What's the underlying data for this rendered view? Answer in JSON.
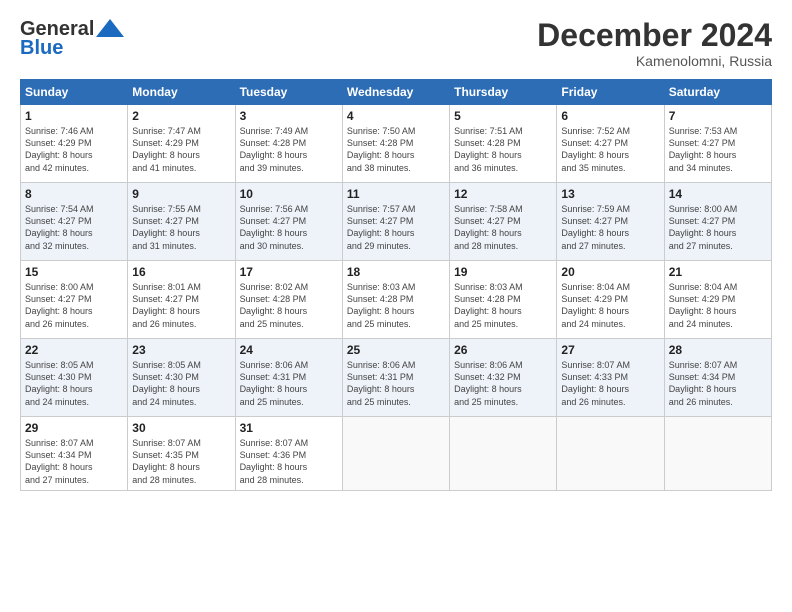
{
  "header": {
    "logo_line1": "General",
    "logo_line2": "Blue",
    "month": "December 2024",
    "location": "Kamenolomni, Russia"
  },
  "days_of_week": [
    "Sunday",
    "Monday",
    "Tuesday",
    "Wednesday",
    "Thursday",
    "Friday",
    "Saturday"
  ],
  "weeks": [
    [
      {
        "day": "1",
        "info": "Sunrise: 7:46 AM\nSunset: 4:29 PM\nDaylight: 8 hours\nand 42 minutes."
      },
      {
        "day": "2",
        "info": "Sunrise: 7:47 AM\nSunset: 4:29 PM\nDaylight: 8 hours\nand 41 minutes."
      },
      {
        "day": "3",
        "info": "Sunrise: 7:49 AM\nSunset: 4:28 PM\nDaylight: 8 hours\nand 39 minutes."
      },
      {
        "day": "4",
        "info": "Sunrise: 7:50 AM\nSunset: 4:28 PM\nDaylight: 8 hours\nand 38 minutes."
      },
      {
        "day": "5",
        "info": "Sunrise: 7:51 AM\nSunset: 4:28 PM\nDaylight: 8 hours\nand 36 minutes."
      },
      {
        "day": "6",
        "info": "Sunrise: 7:52 AM\nSunset: 4:27 PM\nDaylight: 8 hours\nand 35 minutes."
      },
      {
        "day": "7",
        "info": "Sunrise: 7:53 AM\nSunset: 4:27 PM\nDaylight: 8 hours\nand 34 minutes."
      }
    ],
    [
      {
        "day": "8",
        "info": "Sunrise: 7:54 AM\nSunset: 4:27 PM\nDaylight: 8 hours\nand 32 minutes."
      },
      {
        "day": "9",
        "info": "Sunrise: 7:55 AM\nSunset: 4:27 PM\nDaylight: 8 hours\nand 31 minutes."
      },
      {
        "day": "10",
        "info": "Sunrise: 7:56 AM\nSunset: 4:27 PM\nDaylight: 8 hours\nand 30 minutes."
      },
      {
        "day": "11",
        "info": "Sunrise: 7:57 AM\nSunset: 4:27 PM\nDaylight: 8 hours\nand 29 minutes."
      },
      {
        "day": "12",
        "info": "Sunrise: 7:58 AM\nSunset: 4:27 PM\nDaylight: 8 hours\nand 28 minutes."
      },
      {
        "day": "13",
        "info": "Sunrise: 7:59 AM\nSunset: 4:27 PM\nDaylight: 8 hours\nand 27 minutes."
      },
      {
        "day": "14",
        "info": "Sunrise: 8:00 AM\nSunset: 4:27 PM\nDaylight: 8 hours\nand 27 minutes."
      }
    ],
    [
      {
        "day": "15",
        "info": "Sunrise: 8:00 AM\nSunset: 4:27 PM\nDaylight: 8 hours\nand 26 minutes."
      },
      {
        "day": "16",
        "info": "Sunrise: 8:01 AM\nSunset: 4:27 PM\nDaylight: 8 hours\nand 26 minutes."
      },
      {
        "day": "17",
        "info": "Sunrise: 8:02 AM\nSunset: 4:28 PM\nDaylight: 8 hours\nand 25 minutes."
      },
      {
        "day": "18",
        "info": "Sunrise: 8:03 AM\nSunset: 4:28 PM\nDaylight: 8 hours\nand 25 minutes."
      },
      {
        "day": "19",
        "info": "Sunrise: 8:03 AM\nSunset: 4:28 PM\nDaylight: 8 hours\nand 25 minutes."
      },
      {
        "day": "20",
        "info": "Sunrise: 8:04 AM\nSunset: 4:29 PM\nDaylight: 8 hours\nand 24 minutes."
      },
      {
        "day": "21",
        "info": "Sunrise: 8:04 AM\nSunset: 4:29 PM\nDaylight: 8 hours\nand 24 minutes."
      }
    ],
    [
      {
        "day": "22",
        "info": "Sunrise: 8:05 AM\nSunset: 4:30 PM\nDaylight: 8 hours\nand 24 minutes."
      },
      {
        "day": "23",
        "info": "Sunrise: 8:05 AM\nSunset: 4:30 PM\nDaylight: 8 hours\nand 24 minutes."
      },
      {
        "day": "24",
        "info": "Sunrise: 8:06 AM\nSunset: 4:31 PM\nDaylight: 8 hours\nand 25 minutes."
      },
      {
        "day": "25",
        "info": "Sunrise: 8:06 AM\nSunset: 4:31 PM\nDaylight: 8 hours\nand 25 minutes."
      },
      {
        "day": "26",
        "info": "Sunrise: 8:06 AM\nSunset: 4:32 PM\nDaylight: 8 hours\nand 25 minutes."
      },
      {
        "day": "27",
        "info": "Sunrise: 8:07 AM\nSunset: 4:33 PM\nDaylight: 8 hours\nand 26 minutes."
      },
      {
        "day": "28",
        "info": "Sunrise: 8:07 AM\nSunset: 4:34 PM\nDaylight: 8 hours\nand 26 minutes."
      }
    ],
    [
      {
        "day": "29",
        "info": "Sunrise: 8:07 AM\nSunset: 4:34 PM\nDaylight: 8 hours\nand 27 minutes."
      },
      {
        "day": "30",
        "info": "Sunrise: 8:07 AM\nSunset: 4:35 PM\nDaylight: 8 hours\nand 28 minutes."
      },
      {
        "day": "31",
        "info": "Sunrise: 8:07 AM\nSunset: 4:36 PM\nDaylight: 8 hours\nand 28 minutes."
      },
      {
        "day": "",
        "info": ""
      },
      {
        "day": "",
        "info": ""
      },
      {
        "day": "",
        "info": ""
      },
      {
        "day": "",
        "info": ""
      }
    ]
  ]
}
